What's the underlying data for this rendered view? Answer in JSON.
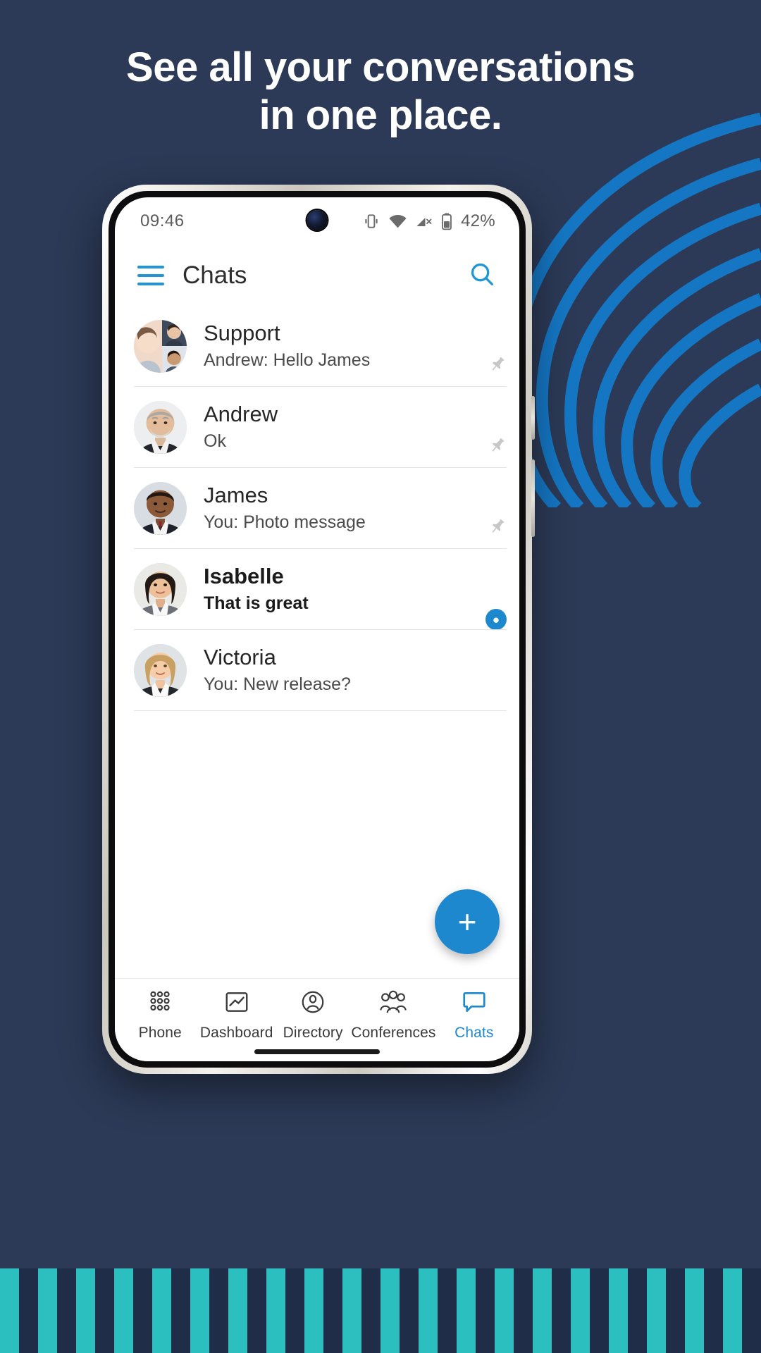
{
  "promo": {
    "headline_line1": "See all your conversations",
    "headline_line2": "in one place."
  },
  "colors": {
    "background": "#2c3a57",
    "accent_blue": "#1e88cf",
    "arc_blue": "#1577c4",
    "stripe_teal": "#2bbfc0",
    "stripe_dark": "#1f2d48"
  },
  "status_bar": {
    "time": "09:46",
    "battery_percent": "42%",
    "icons": [
      "vibrate-icon",
      "wifi-icon",
      "signal-off-icon",
      "battery-icon"
    ]
  },
  "app_bar": {
    "menu_icon": "hamburger-menu-icon",
    "title": "Chats",
    "search_icon": "search-icon"
  },
  "chats": [
    {
      "name": "Support",
      "preview": "Andrew: Hello James",
      "avatar_type": "group",
      "pinned": true,
      "unread": false
    },
    {
      "name": "Andrew",
      "preview": "Ok",
      "avatar_type": "man-grey-beard",
      "pinned": true,
      "unread": false
    },
    {
      "name": "James",
      "preview": "You: Photo message",
      "avatar_type": "man-dark-suit",
      "pinned": true,
      "unread": false
    },
    {
      "name": "Isabelle",
      "preview": "That is great",
      "avatar_type": "woman-dark-hair",
      "pinned": false,
      "unread": true
    },
    {
      "name": "Victoria",
      "preview": "You: New release?",
      "avatar_type": "woman-blonde",
      "pinned": false,
      "unread": false
    }
  ],
  "fab": {
    "label": "+",
    "icon": "plus-icon"
  },
  "bottom_nav": {
    "active": "Chats",
    "items": [
      {
        "label": "Phone",
        "icon": "dialpad-icon"
      },
      {
        "label": "Dashboard",
        "icon": "chart-icon"
      },
      {
        "label": "Directory",
        "icon": "person-circle-icon"
      },
      {
        "label": "Conferences",
        "icon": "group-people-icon"
      },
      {
        "label": "Chats",
        "icon": "chat-bubble-icon"
      }
    ]
  }
}
